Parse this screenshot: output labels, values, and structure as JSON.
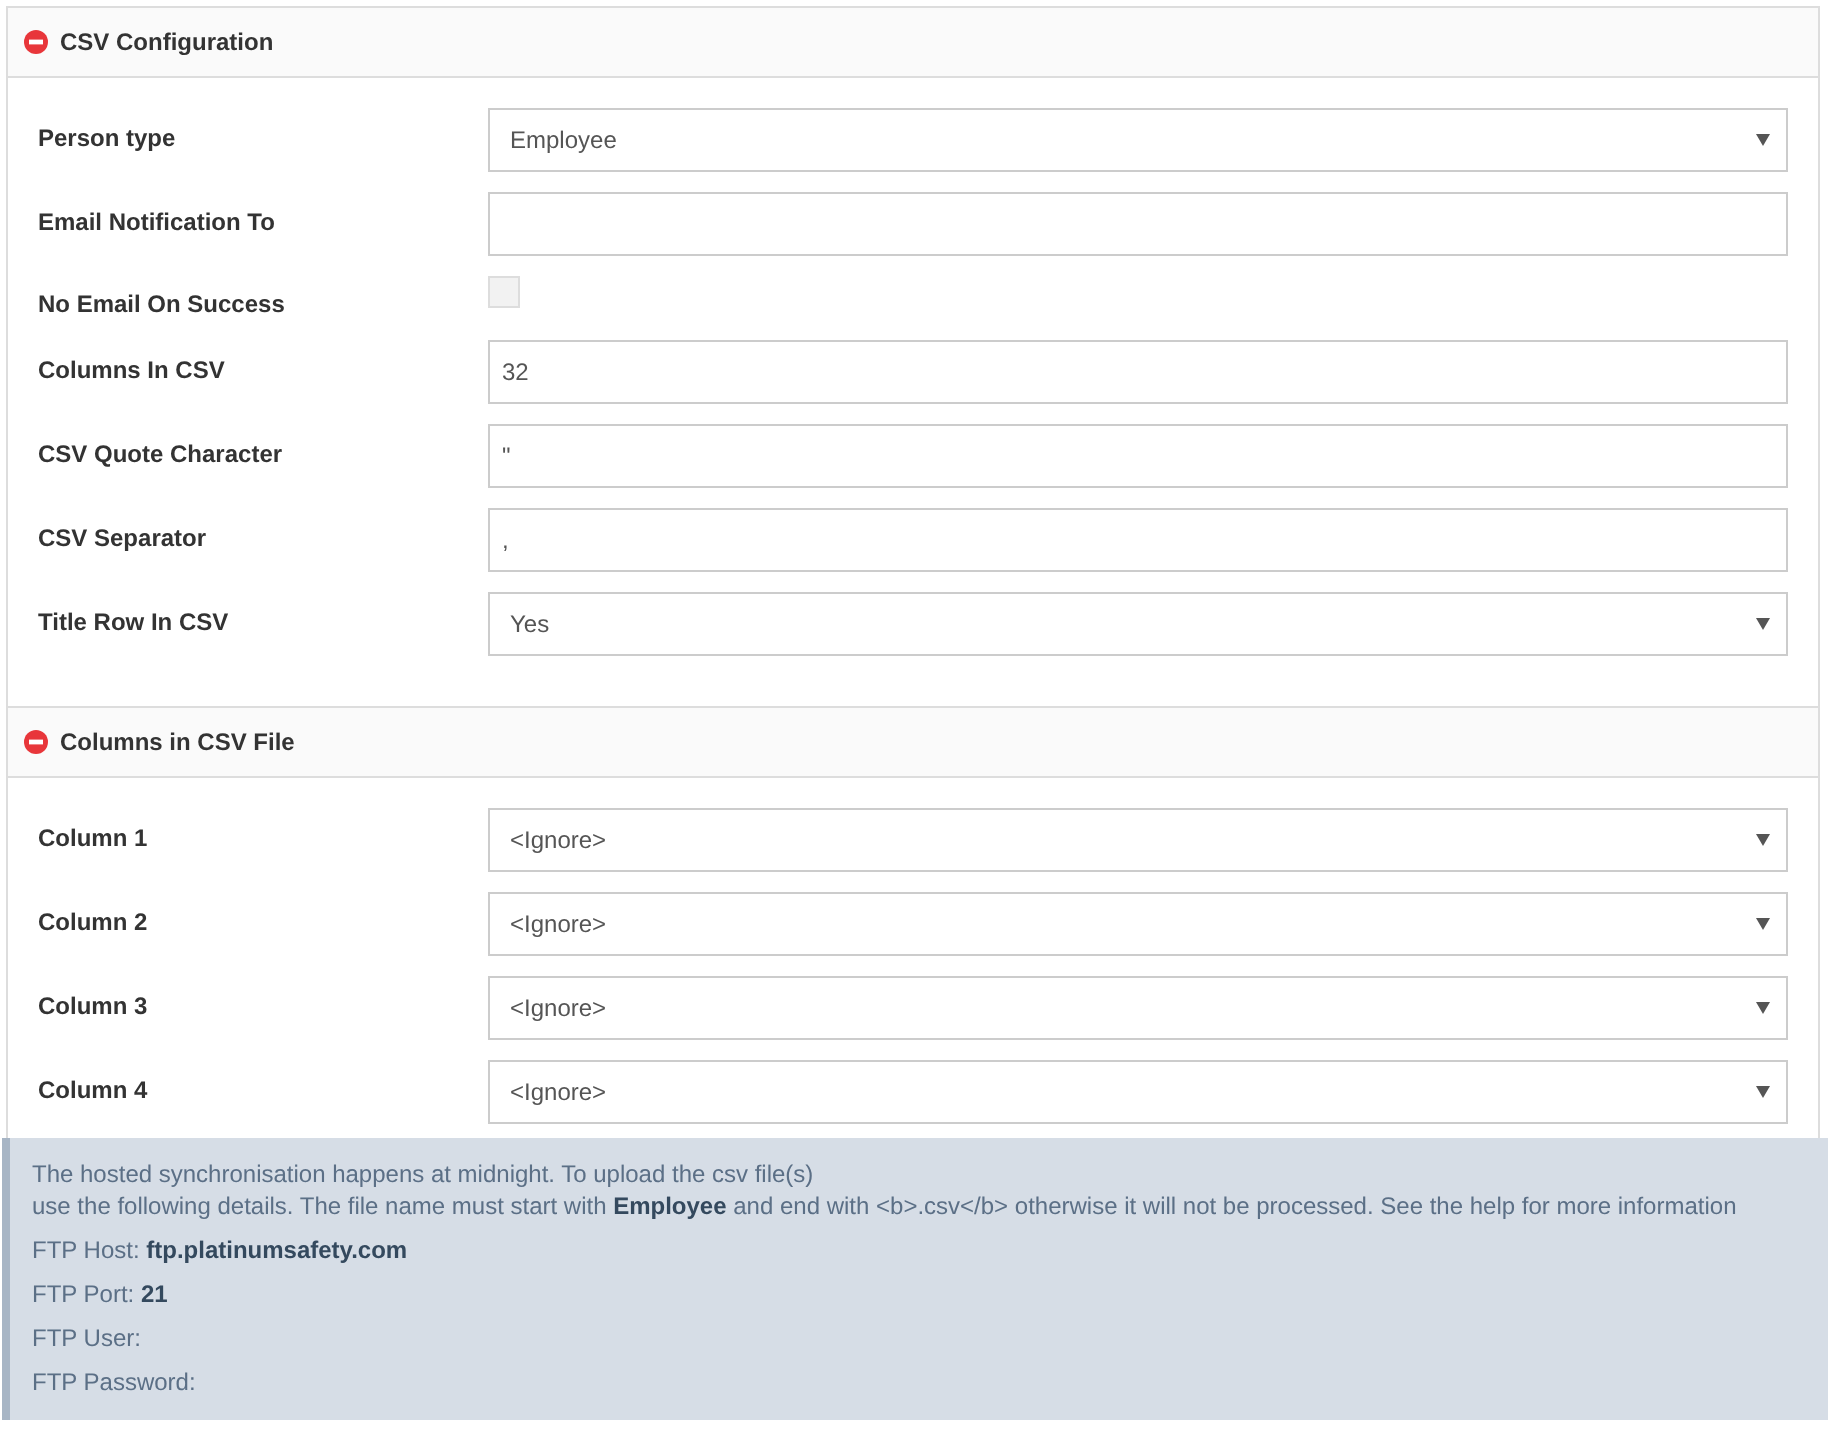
{
  "sections": [
    {
      "title": "CSV Configuration",
      "expanded": true,
      "fields": [
        {
          "kind": "select",
          "label": "Person type",
          "value": "Employee"
        },
        {
          "kind": "text",
          "label": "Email Notification To"
        },
        {
          "kind": "checkbox",
          "label": "No Email On Success",
          "checked": false
        },
        {
          "kind": "text",
          "label": "Columns In CSV",
          "value": "32"
        },
        {
          "kind": "text",
          "label": "CSV Quote Character",
          "value": "\""
        },
        {
          "kind": "text",
          "label": "CSV Separator",
          "value": ","
        },
        {
          "kind": "select",
          "label": "Title Row In CSV",
          "value": "Yes"
        }
      ]
    },
    {
      "title": "Columns in CSV File",
      "expanded": true,
      "fields": [
        {
          "kind": "select",
          "label": "Column 1",
          "value": "<Ignore>"
        },
        {
          "kind": "select",
          "label": "Column 2",
          "value": "<Ignore>"
        },
        {
          "kind": "select",
          "label": "Column 3",
          "value": "<Ignore>"
        },
        {
          "kind": "select",
          "label": "Column 4",
          "value": "<Ignore>"
        }
      ]
    }
  ],
  "info": {
    "intro": "The hosted synchronisation happens at midnight. To upload the csv file(s)\nuse the following details. The file name must start with **Employee** and end with <b>.csv</b> otherwise it will not be processed. See the help for more information",
    "details": [
      "FTP Host: **ftp.platinumsafety.com**",
      "FTP Port: **21**",
      "FTP User:",
      "FTP Password:"
    ]
  }
}
